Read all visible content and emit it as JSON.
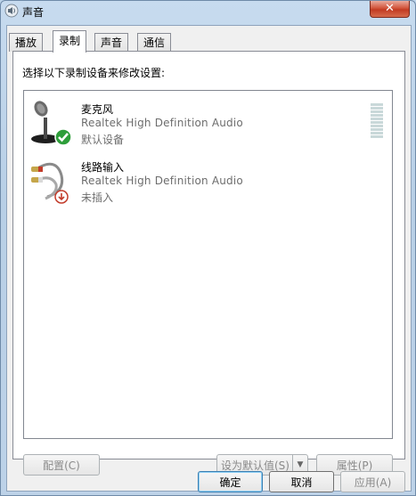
{
  "window": {
    "title": "声音",
    "close_label": "✕"
  },
  "tabs": [
    {
      "label": "播放",
      "active": false
    },
    {
      "label": "录制",
      "active": true
    },
    {
      "label": "声音",
      "active": false
    },
    {
      "label": "通信",
      "active": false
    }
  ],
  "panel": {
    "instruction": "选择以下录制设备来修改设置:",
    "devices": [
      {
        "name": "麦克风",
        "driver": "Realtek High Definition Audio",
        "status": "默认设备",
        "icon": "microphone-icon",
        "badge": "check-badge-icon"
      },
      {
        "name": "线路输入",
        "driver": "Realtek High Definition Audio",
        "status": "未插入",
        "icon": "line-in-cable-icon",
        "badge": "unplugged-badge-icon"
      }
    ],
    "buttons": {
      "configure": "配置(C)",
      "set_default": "设为默认值(S)",
      "properties": "属性(P)"
    }
  },
  "footer": {
    "ok": "确定",
    "cancel": "取消",
    "apply": "应用(A)"
  }
}
